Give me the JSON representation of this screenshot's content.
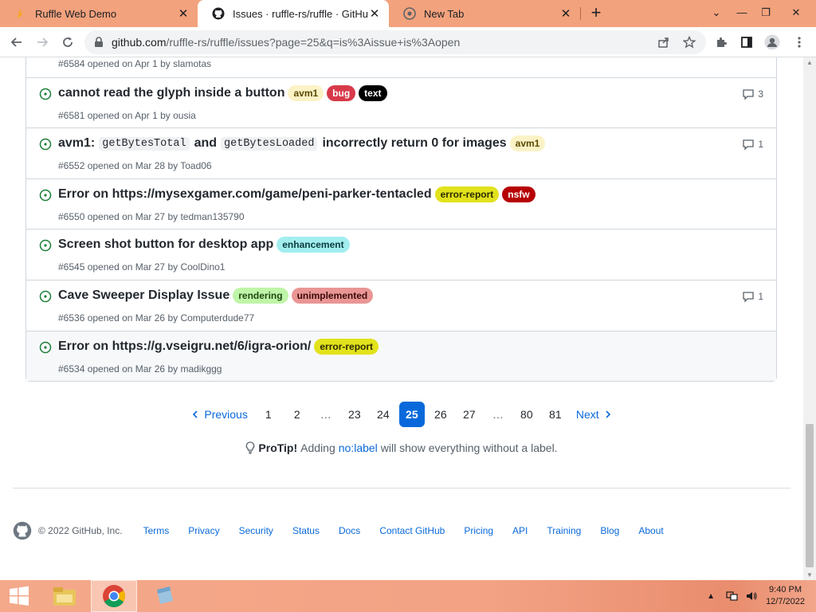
{
  "browser": {
    "tabs": [
      {
        "title": "Ruffle Web Demo",
        "favicon": "ruffle-icon",
        "active": false
      },
      {
        "title": "Issues · ruffle-rs/ruffle · GitHub",
        "favicon": "github-icon",
        "active": true
      },
      {
        "title": "New Tab",
        "favicon": "chrome-icon",
        "active": false
      }
    ],
    "url_host": "github.com",
    "url_path": "/ruffle-rs/ruffle/issues?page=25&q=is%3Aissue+is%3Aopen"
  },
  "issues": [
    {
      "title": "",
      "labels": [],
      "meta": "#6584 opened on Apr 1 by slamotas",
      "comments": ""
    },
    {
      "title": "cannot read the glyph inside a button",
      "labels": [
        {
          "name": "avm1",
          "bg": "#fbf3c6",
          "fg": "#5a4a00"
        },
        {
          "name": "bug",
          "bg": "#d73a4a",
          "fg": "#ffffff"
        },
        {
          "name": "text",
          "bg": "#000000",
          "fg": "#ffffff"
        }
      ],
      "meta": "#6581 opened on Apr 1 by ousia",
      "comments": "3"
    },
    {
      "title_parts": [
        "avm1:",
        "getBytesTotal",
        "and",
        "getBytesLoaded",
        "incorrectly return 0 for images"
      ],
      "labels": [
        {
          "name": "avm1",
          "bg": "#fbf3c6",
          "fg": "#5a4a00"
        }
      ],
      "meta": "#6552 opened on Mar 28 by Toad06",
      "comments": "1"
    },
    {
      "title": "Error on https://mysexgamer.com/game/peni-parker-tentacled",
      "labels": [
        {
          "name": "error-report",
          "bg": "#e2e21c",
          "fg": "#2b2b00"
        },
        {
          "name": "nsfw",
          "bg": "#b60205",
          "fg": "#ffffff"
        }
      ],
      "meta": "#6550 opened on Mar 27 by tedman135790",
      "comments": ""
    },
    {
      "title": "Screen shot button for desktop app",
      "labels": [
        {
          "name": "enhancement",
          "bg": "#a2eeef",
          "fg": "#0b3c3d"
        }
      ],
      "meta": "#6545 opened on Mar 27 by CoolDino1",
      "comments": ""
    },
    {
      "title": "Cave Sweeper Display Issue",
      "labels": [
        {
          "name": "rendering",
          "bg": "#bff5a8",
          "fg": "#1f4a10"
        },
        {
          "name": "unimplemented",
          "bg": "#e99695",
          "fg": "#3b0a0a"
        }
      ],
      "meta": "#6536 opened on Mar 26 by Computerdude77",
      "comments": "1"
    },
    {
      "title": "Error on https://g.vseigru.net/6/igra-orion/",
      "labels": [
        {
          "name": "error-report",
          "bg": "#e2e21c",
          "fg": "#2b2b00"
        }
      ],
      "meta": "#6534 opened on Mar 26 by madikggg",
      "comments": ""
    }
  ],
  "pagination": {
    "previous": "Previous",
    "next": "Next",
    "pages": [
      "1",
      "2",
      "…",
      "23",
      "24",
      "25",
      "26",
      "27",
      "…",
      "80",
      "81"
    ],
    "current": "25"
  },
  "protip": {
    "prefix": "ProTip!",
    "text_before": "Adding",
    "link": "no:label",
    "text_after": "will show everything without a label."
  },
  "footer": {
    "copyright": "© 2022 GitHub, Inc.",
    "links": [
      "Terms",
      "Privacy",
      "Security",
      "Status",
      "Docs",
      "Contact GitHub",
      "Pricing",
      "API",
      "Training",
      "Blog",
      "About"
    ]
  },
  "taskbar": {
    "time": "9:40 PM",
    "date": "12/7/2022"
  },
  "colors": {
    "open_issue": "#1a7f37",
    "link": "#0969da",
    "tabstrip": "#f2a27d"
  }
}
